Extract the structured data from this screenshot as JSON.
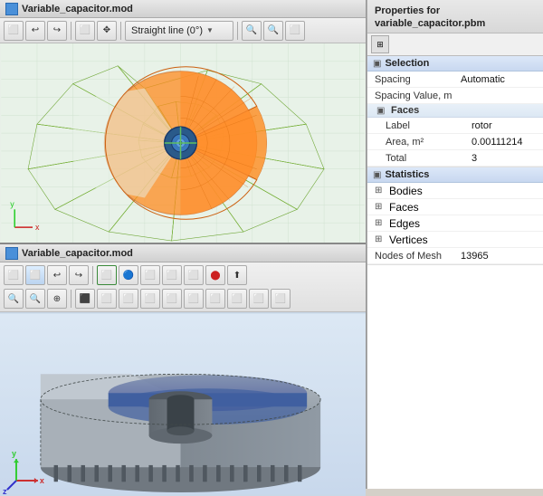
{
  "top_viewport": {
    "title": "Variable_capacitor.mod",
    "toolbar": {
      "buttons": [
        "⬜",
        "↩",
        "↪",
        "⬜",
        "✥",
        "📏"
      ],
      "dropdown_label": "Straight line (0°)",
      "zoom_buttons": [
        "🔍",
        "🔍",
        "⬜"
      ]
    }
  },
  "bottom_viewport": {
    "title": "Variable_capacitor.mod",
    "toolbar_row1": [
      "⬜",
      "⬜",
      "↩",
      "↪",
      "⬜",
      "✥",
      "⬜",
      "⬜",
      "⬜",
      "⬜",
      "⬜",
      "⬜"
    ],
    "toolbar_row2": [
      "🔍",
      "🔍",
      "⊕",
      "⬛",
      "⬜",
      "⬜",
      "⬜",
      "⬜",
      "⬜",
      "⬜",
      "⬜",
      "⬜",
      "⬜",
      "⬜"
    ]
  },
  "properties": {
    "header": "Properties for variable_capacitor.pbm",
    "sections": {
      "selection": {
        "label": "Selection",
        "rows": [
          {
            "key": "Spacing",
            "value": "Automatic"
          },
          {
            "key": "Spacing Value, m",
            "value": ""
          }
        ],
        "faces": {
          "label": "Faces",
          "rows": [
            {
              "key": "Label",
              "value": "rotor"
            },
            {
              "key": "Area, m²",
              "value": "0.00111214"
            },
            {
              "key": "Total",
              "value": "3"
            }
          ]
        }
      },
      "statistics": {
        "label": "Statistics",
        "items": [
          "Bodies",
          "Faces",
          "Edges",
          "Vertices"
        ],
        "nodes_label": "Nodes of Mesh",
        "nodes_value": "13965"
      }
    }
  }
}
